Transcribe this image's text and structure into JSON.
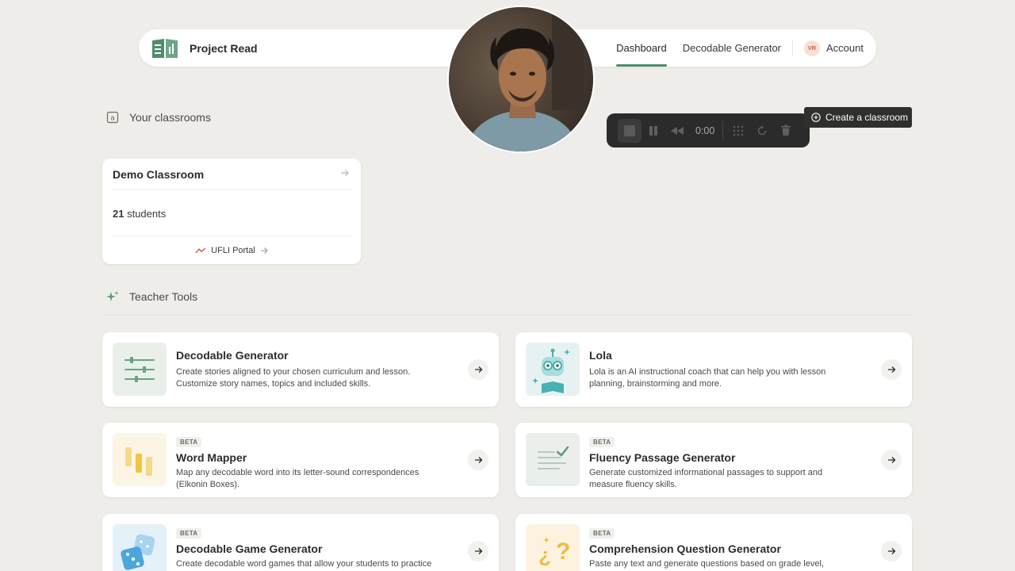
{
  "header": {
    "brand": "Project Read",
    "nav": [
      "Dashboard",
      "Decodable Generator"
    ],
    "active_nav": "Dashboard",
    "account_initials": "VR",
    "account_label": "Account"
  },
  "recorder": {
    "time": "0:00"
  },
  "classrooms": {
    "title": "Your classrooms",
    "create_label": "Create a classroom",
    "card": {
      "name": "Demo Classroom",
      "student_count": "21",
      "student_label": " students",
      "portal_label": "UFLI Portal"
    }
  },
  "tools": {
    "title": "Teacher Tools",
    "items": [
      {
        "badge": "",
        "title": "Decodable Generator",
        "desc": "Create stories aligned to your chosen curriculum and lesson. Customize story names, topics and included skills."
      },
      {
        "badge": "",
        "title": "Lola",
        "desc": "Lola is an AI instructional coach that can help you with lesson planning, brainstorming and more."
      },
      {
        "badge": "BETA",
        "title": "Word Mapper",
        "desc": "Map any decodable word into its letter-sound correspondences (Elkonin Boxes)."
      },
      {
        "badge": "BETA",
        "title": "Fluency Passage Generator",
        "desc": "Generate customized informational passages to support and measure fluency skills."
      },
      {
        "badge": "BETA",
        "title": "Decodable Game Generator",
        "desc": "Create decodable word games that allow your students to practice their decoding skills."
      },
      {
        "badge": "BETA",
        "title": "Comprehension Question Generator",
        "desc": "Paste any text and generate questions based on grade level, Common Core standards and more."
      }
    ]
  },
  "colors": {
    "accent": "#4f8d6c",
    "background": "#eeede9",
    "recorder": "#2b2b2b"
  }
}
